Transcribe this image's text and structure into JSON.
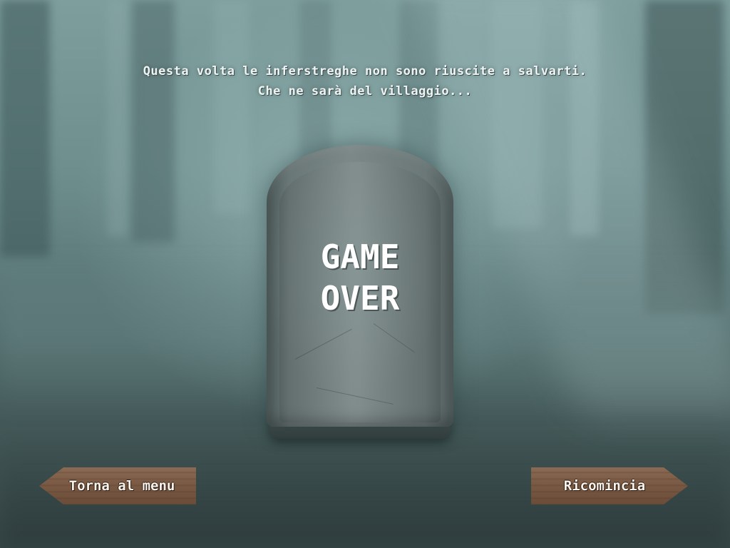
{
  "message": {
    "line1": "Questa volta le inferstreghe non sono riuscite a salvarti.",
    "line2": "Che ne sarà del villaggio..."
  },
  "tombstone": {
    "line1": "GAME",
    "line2": "OVER"
  },
  "buttons": {
    "back_to_menu": "Torna al menu",
    "restart": "Ricomincia"
  },
  "colors": {
    "fog": "#7e9e9e",
    "ground": "#364646",
    "stone": "#7c8888",
    "wood": "#7a5a44",
    "text": "#ffffff"
  }
}
